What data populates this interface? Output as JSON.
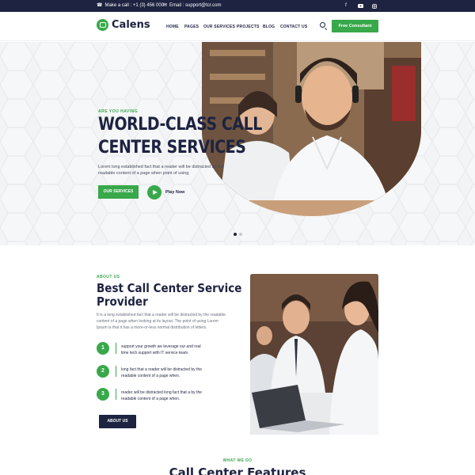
{
  "topbar": {
    "phone_label": "Make a call : +1 (3) 456 000",
    "email_label": "Email : support@tcr.com",
    "social": [
      "facebook-icon",
      "youtube-icon",
      "instagram-icon"
    ]
  },
  "brand": {
    "name": "Calens",
    "accent": "#38a84a",
    "dark": "#1d2340"
  },
  "nav": {
    "items": [
      "HOME",
      "PAGES",
      "OUR SERVICES",
      "PROJECTS",
      "BLOG",
      "CONTACT US"
    ],
    "cta": "Free Consultant"
  },
  "hero": {
    "eyebrow": "ARE YOU HAVING",
    "title_line1": "WORLD-CLASS CALL",
    "title_line2": "CENTER SERVICES",
    "desc_line1": "Lorem long established fact that a reader will be distracted by the",
    "desc_line2": "readable content of a page when point of using",
    "primary_button": "OUR SERVICES",
    "play_label": "Play Now",
    "slide_count": 2,
    "active_slide": 1
  },
  "about": {
    "eyebrow": "ABOUT US",
    "title_line1": "Best Call Center Service",
    "title_line2": "Provider",
    "desc_lines": [
      "It is a long established fact that a reader will be distracted by the readable",
      "content of a page when looking at its layout. The point of using Lorem",
      "Ipsum is that it has a more-or-less normal distribution of letters."
    ],
    "features": [
      {
        "num": "1",
        "line1": "support your growth we leverage our and real",
        "line2": "time tech support with IT service team."
      },
      {
        "num": "2",
        "line1": "long fact that a reader will be distracted by the",
        "line2": "readable content of a page when."
      },
      {
        "num": "3",
        "line1": "reader will be distracted long fact that a by the",
        "line2": "readable content of a page when."
      }
    ],
    "button": "ABOUT US"
  },
  "services": {
    "eyebrow": "WHAT WE DO",
    "title": "Call Center Features"
  }
}
